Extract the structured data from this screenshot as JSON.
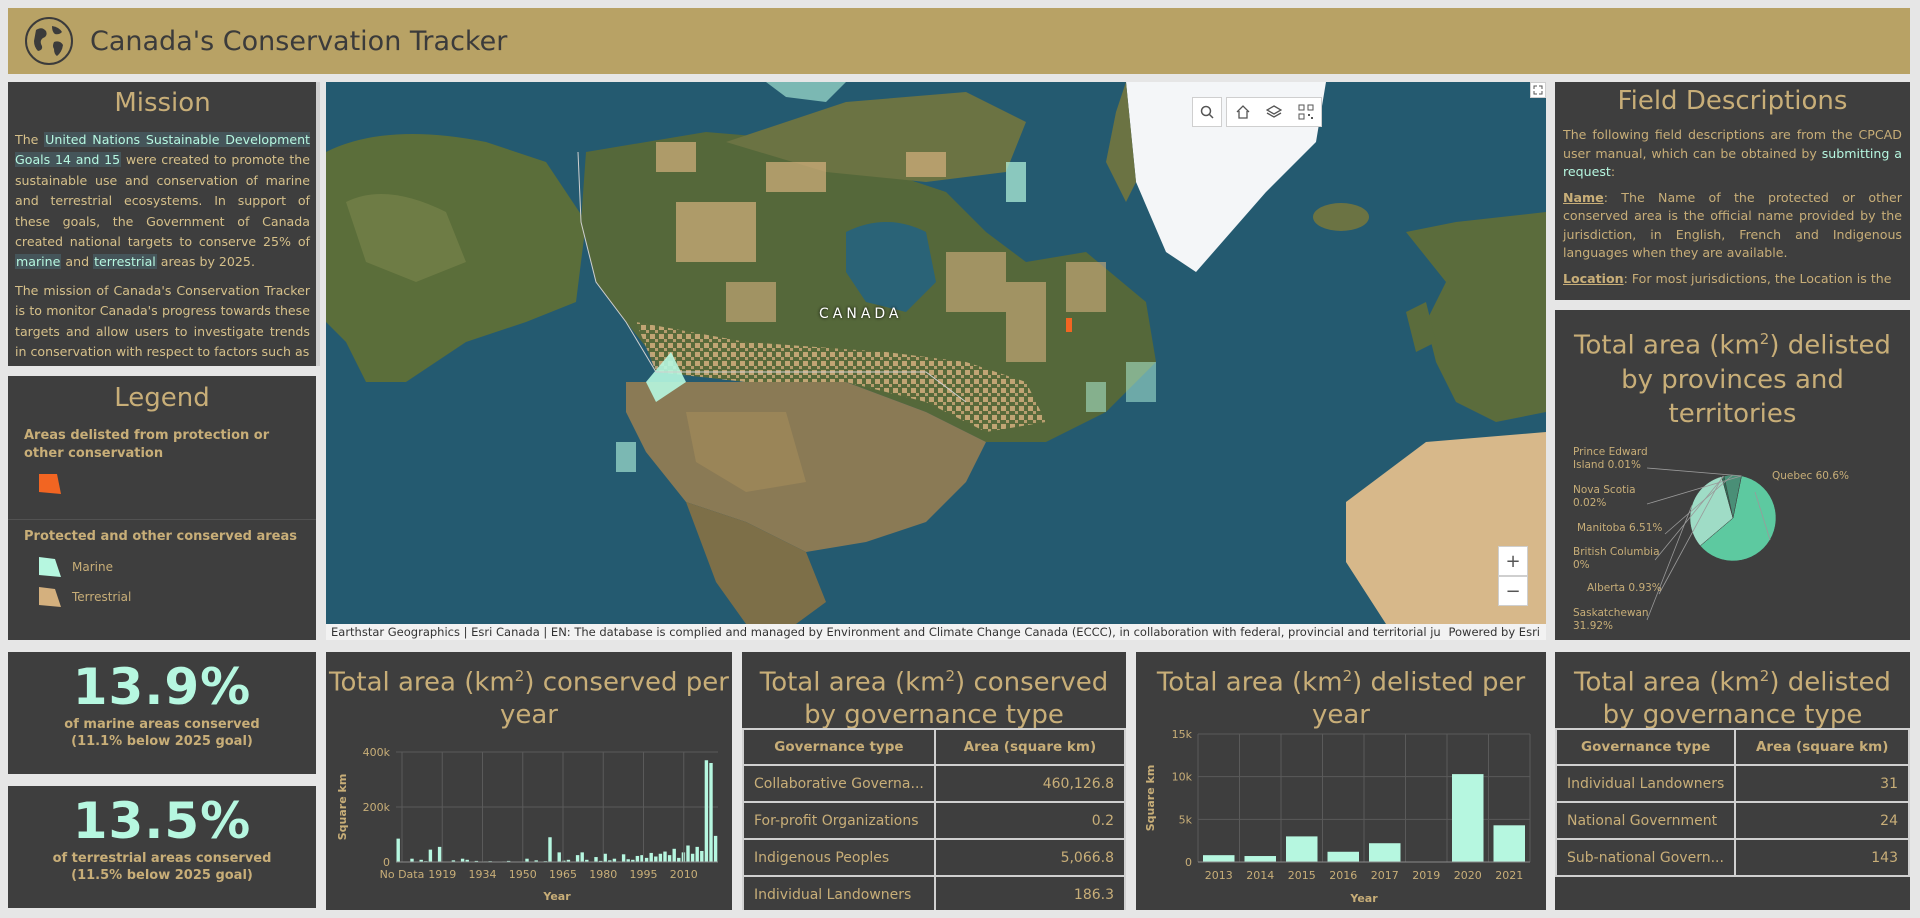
{
  "header": {
    "title": "Canada's Conservation Tracker"
  },
  "mission": {
    "title": "Mission",
    "p1_a": "The ",
    "p1_link": "United Nations Sustainable Development Goals 14 and 15",
    "p1_b": " were created to promote the sustainable use and conservation of marine and terrestrial ecosystems. In support of these goals, the Government of Canada created national targets to conserve 25% of ",
    "p1_marine": "marine",
    "p1_c": " and ",
    "p1_terrestrial": "terrestrial",
    "p1_d": " areas by 2025.",
    "p2": "The mission of Canada's Conservation Tracker is to monitor Canada's progress towards these targets and allow users to investigate trends in conservation with respect to factors such as"
  },
  "legend": {
    "title": "Legend",
    "delisted_heading": "Areas delisted from protection or other conservation",
    "protected_heading": "Protected and other conserved areas",
    "marine_label": "Marine",
    "terrestrial_label": "Terrestrial",
    "colors": {
      "delisted": "#f26522",
      "marine": "#b6f7e0",
      "terrestrial": "#d4b07e"
    }
  },
  "map": {
    "country_label": "CANADA",
    "attribution": "Earthstar Geographics | Esri Canada | EN: The database is complied and managed by Environment and Climate Change Canada (ECCC), in collaboration with federal, provincial and territorial jurisdictions. ...",
    "powered_by": "Powered by Esri",
    "zoom_in": "+",
    "zoom_out": "−"
  },
  "fields": {
    "title": "Field Descriptions",
    "intro_a": "The following field descriptions are from the CPCAD user manual, which can be obtained by ",
    "intro_link": "submitting a request",
    "intro_b": ":",
    "name_term": "Name",
    "name_desc": ": The Name of the protected or other conserved area is the official name provided by the jurisdiction, in English, French and Indigenous languages when they are available.",
    "location_term": "Location",
    "location_desc": ": For most jurisdictions, the Location is the"
  },
  "stats": {
    "marine_value": "13.9%",
    "marine_line1": "of marine areas conserved",
    "marine_line2": "(11.1% below 2025 goal)",
    "terrestrial_value": "13.5%",
    "terrestrial_line1": "of terrestrial areas conserved",
    "terrestrial_line2": "(11.5% below 2025 goal)"
  },
  "panels": {
    "conserved_year_title_a": "Total area (km",
    "conserved_year_title_b": ") conserved per year",
    "conserved_gov_title_a": "Total area (km",
    "conserved_gov_title_b": ") conserved by governance type",
    "delisted_year_title_a": "Total area (km",
    "delisted_year_title_b": ") delisted per  year",
    "delisted_gov_title_a": "Total area (km",
    "delisted_gov_title_b": ") delisted by governance type",
    "delisted_prov_title_a": "Total area (km",
    "delisted_prov_title_b": ") delisted by provinces and territories",
    "sup": "2"
  },
  "conserved_gov_table": {
    "headers": [
      "Governance type",
      "Area (square km)"
    ],
    "rows": [
      [
        "Collaborative Governa...",
        "460,126.8"
      ],
      [
        "For-profit Organizations",
        "0.2"
      ],
      [
        "Indigenous Peoples",
        "5,066.8"
      ],
      [
        "Individual Landowners",
        "186.3"
      ]
    ]
  },
  "delisted_gov_table": {
    "headers": [
      "Governance type",
      "Area (square km)"
    ],
    "rows": [
      [
        "Individual Landowners",
        "31"
      ],
      [
        "National Government",
        "24"
      ],
      [
        "Sub-national Govern...",
        "143"
      ]
    ]
  },
  "chart_data": [
    {
      "type": "bar",
      "title": "Total area (km2) conserved per year",
      "xlabel": "Year",
      "ylabel": "Square km",
      "ylim": [
        0,
        400000
      ],
      "yticks": [
        "0",
        "200k",
        "400k"
      ],
      "xticks": [
        "No Data",
        "1919",
        "1934",
        "1950",
        "1965",
        "1980",
        "1995",
        "2010"
      ],
      "values": [
        85000,
        0,
        0,
        12000,
        0,
        8000,
        3000,
        45000,
        0,
        55000,
        0,
        0,
        6000,
        0,
        12000,
        8000,
        0,
        4000,
        0,
        2000,
        3000,
        0,
        0,
        2000,
        4000,
        0,
        0,
        0,
        12000,
        0,
        6000,
        0,
        3000,
        90000,
        0,
        35000,
        5000,
        8000,
        0,
        25000,
        35000,
        8000,
        0,
        18000,
        4000,
        30000,
        6000,
        12000,
        2000,
        28000,
        10000,
        8000,
        22000,
        25000,
        15000,
        33000,
        20000,
        30000,
        38000,
        25000,
        48000,
        15000,
        35000,
        60000,
        30000,
        55000,
        40000,
        370000,
        360000,
        95000
      ],
      "color": "#b6f7e0"
    },
    {
      "type": "bar",
      "title": "Total area (km2) delisted per  year",
      "xlabel": "Year",
      "ylabel": "Square km",
      "ylim": [
        0,
        15000
      ],
      "yticks": [
        "0",
        "5k",
        "10k",
        "15k"
      ],
      "categories": [
        "2013",
        "2014",
        "2015",
        "2016",
        "2017",
        "2019",
        "2020",
        "2021"
      ],
      "values": [
        800,
        700,
        3000,
        1200,
        2200,
        50,
        10300,
        4300
      ],
      "color": "#b6f7e0"
    },
    {
      "type": "pie",
      "title": "Total area (km2) delisted by provinces and territories",
      "categories": [
        "Quebec",
        "Saskatchewan",
        "Alberta",
        "British Columbia",
        "Manitoba",
        "Nova Scotia",
        "Prince Edward Island"
      ],
      "values": [
        60.6,
        31.92,
        0.93,
        0,
        6.51,
        0.02,
        0.01
      ],
      "labels": [
        "Quebec 60.6%",
        "Saskatchewan 31.92%",
        "Alberta 0.93%",
        "British Columbia 0%",
        "Manitoba 6.51%",
        "Nova Scotia 0.02%",
        "Prince Edward Island 0.01%"
      ],
      "colors": [
        "#5dc9a0",
        "#9fdcc6",
        "#2f6e58",
        "#8fcfb8",
        "#4a8f77",
        "#2a5a48",
        "#6fb89c"
      ]
    }
  ]
}
